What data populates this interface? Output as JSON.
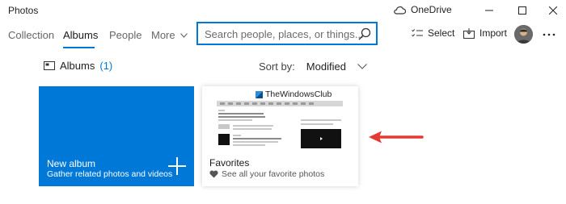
{
  "titlebar": {
    "app_title": "Photos",
    "onedrive_label": "OneDrive"
  },
  "nav": {
    "tabs": [
      {
        "label": "Collection",
        "active": false
      },
      {
        "label": "Albums",
        "active": true
      },
      {
        "label": "People",
        "active": false
      }
    ],
    "more_label": "More"
  },
  "search": {
    "placeholder": "Search people, places, or things..."
  },
  "actions": {
    "select_label": "Select",
    "import_label": "Import"
  },
  "albums": {
    "heading": "Albums",
    "count": "(1)",
    "sort_label": "Sort by:",
    "sort_value": "Modified"
  },
  "tiles": {
    "new_album": {
      "title": "New album",
      "subtitle": "Gather related photos and videos"
    },
    "favorites": {
      "title": "Favorites",
      "subtitle": "See all your favorite photos",
      "thumbnail_brand": "TheWindowsClub"
    }
  },
  "colors": {
    "accent": "#0078d7",
    "annotation_arrow": "#e53935"
  },
  "icons": {
    "onedrive": "cloud-icon",
    "select": "checklist-icon",
    "import": "import-icon",
    "albums": "album-icon",
    "favorites": "heart-icon",
    "search": "search-icon"
  }
}
